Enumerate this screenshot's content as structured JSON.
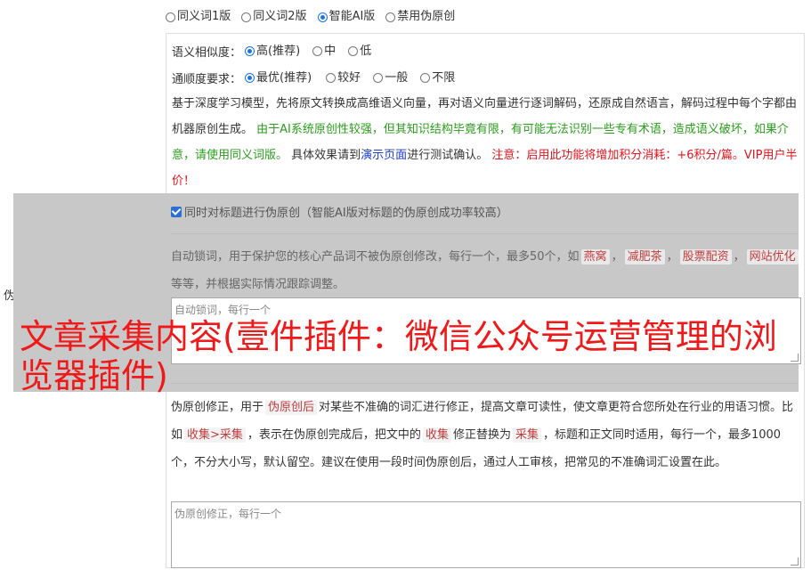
{
  "version_options": [
    {
      "label": "同义词1版",
      "selected": false
    },
    {
      "label": "同义词2版",
      "selected": false
    },
    {
      "label": "智能AI版",
      "selected": true
    },
    {
      "label": "禁用伪原创",
      "selected": false
    }
  ],
  "similarity": {
    "label": "语义相似度：",
    "options": [
      {
        "label": "高(推荐)",
        "selected": true
      },
      {
        "label": "中",
        "selected": false
      },
      {
        "label": "低",
        "selected": false
      }
    ]
  },
  "fluency": {
    "label": "通顺度要求：",
    "options": [
      {
        "label": "最优(推荐)",
        "selected": true
      },
      {
        "label": "较好",
        "selected": false
      },
      {
        "label": "一般",
        "selected": false
      },
      {
        "label": "不限",
        "selected": false
      }
    ]
  },
  "desc": {
    "p1": "基于深度学习模型，先将原文转换成高维语义向量，再对语义向量进行逐词解码，还原成自然语言，解码过程中每个字都由机器原创生成。",
    "p2_green": "由于AI系统原创性较强，但其知识结构毕竟有限，有可能无法识别一些专有术语，造成语义破坏，如果介意，请使用同义词版。",
    "p3": "具体效果请到",
    "p3_link": "演示页面",
    "p3_end": "进行测试确认。",
    "p4_red": "注意：启用此功能将增加积分消耗：+6积分/篇。VIP用户半价！"
  },
  "side_label": "伪原创设置",
  "title_checkbox": "同时对标题进行伪原创（智能AI版对标题的伪原创成功率较高）",
  "lock": {
    "text_before": "自动锁词，用于保护您的核心产品词不被伪原创修改，每行一个，最多50个，如",
    "tags": [
      "燕窝",
      "减肥茶",
      "股票配资",
      "网站优化"
    ],
    "text_after": "等等，并根据实际情况跟踪调整。",
    "placeholder": "自动锁词，每行一个"
  },
  "fix": {
    "t1": "伪原创修正，用于",
    "tag1": "伪原创后",
    "t2": "对某些不准确的词汇进行修正，提高文章可读性，使文章更符合您所处在行业的用语习惯。比如",
    "tag2": "收集>采集",
    "t3": "，表示在伪原创完成后，把文中的",
    "tag3": "收集",
    "t4": "修正替换为",
    "tag4": "采集",
    "t5": "，标题和正文同时适用，每行一个，最多1000个，不分大小写，默认留空。建议在使用一段时间伪原创后，通过人工审核，把常见的不准确词汇设置在此。",
    "placeholder": "伪原创修正，每行一个"
  },
  "overlay_title": "文章采集内容(壹件插件：微信公众号运营管理的浏览器插件)"
}
